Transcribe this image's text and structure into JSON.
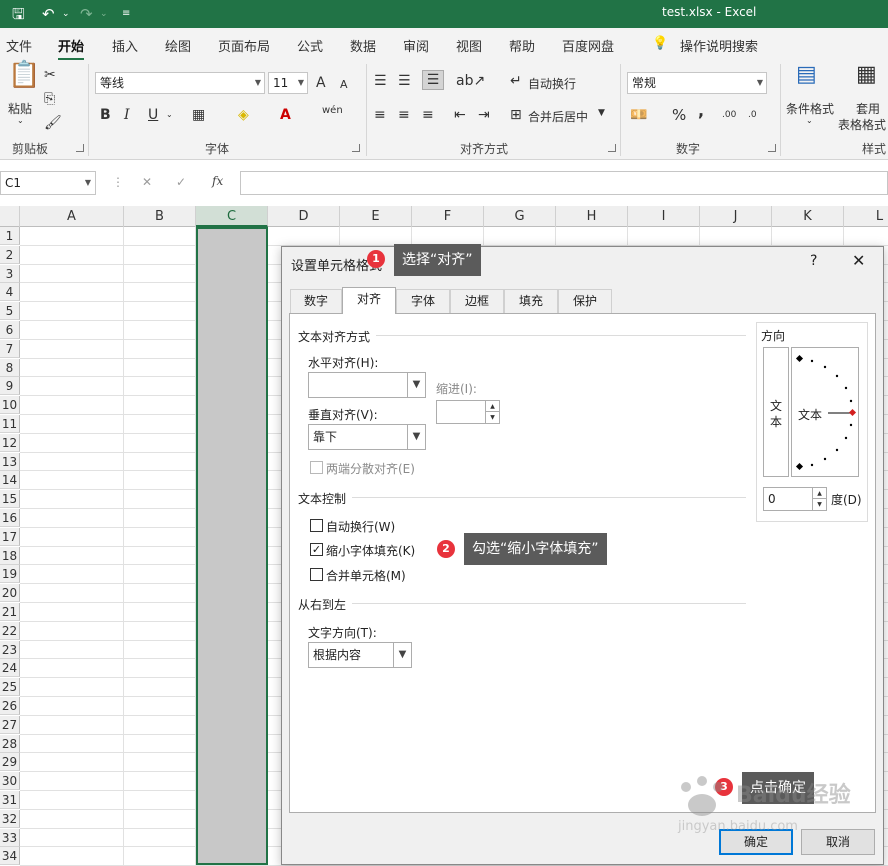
{
  "titlebar": {
    "title": "test.xlsx  -  Excel"
  },
  "ribbon_tabs": [
    "文件",
    "开始",
    "插入",
    "绘图",
    "页面布局",
    "公式",
    "数据",
    "审阅",
    "视图",
    "帮助",
    "百度网盘"
  ],
  "tell_me": "操作说明搜索",
  "clipboard": {
    "paste": "粘贴",
    "label": "剪贴板"
  },
  "font": {
    "name": "等线",
    "size": "11",
    "label": "字体",
    "bold": "B",
    "italic": "I",
    "underline": "U",
    "grow": "A",
    "shrink": "A",
    "wen": "wén"
  },
  "alignment": {
    "wrap": "自动换行",
    "merge": "合并后居中",
    "label": "对齐方式"
  },
  "number": {
    "format": "常规",
    "percent": "%",
    "comma": ",",
    "label": "数字"
  },
  "styles": {
    "conditional": "条件格式",
    "table1": "套用",
    "table2": "表格格式",
    "label": "样式"
  },
  "formula_bar": {
    "name_box": "C1",
    "fx": "fx",
    "cancel": "✕",
    "enter": "✓"
  },
  "grid": {
    "columns": [
      "A",
      "B",
      "C",
      "D",
      "E",
      "F",
      "G",
      "H",
      "I",
      "J",
      "K",
      "L"
    ],
    "rows": [
      "1",
      "2",
      "3",
      "4",
      "5",
      "6",
      "7",
      "8",
      "9",
      "10",
      "11",
      "12",
      "13",
      "14",
      "15",
      "16",
      "17",
      "18",
      "19",
      "20",
      "21",
      "22",
      "23",
      "24",
      "25",
      "26",
      "27",
      "28",
      "29",
      "30",
      "31",
      "32",
      "33",
      "34"
    ],
    "selected_column": "C"
  },
  "dialog": {
    "title": "设置单元格格式",
    "help": "?",
    "close": "✕",
    "tabs": [
      "数字",
      "对齐",
      "字体",
      "边框",
      "填充",
      "保护"
    ],
    "active_tab": "对齐",
    "text_alignment": {
      "section": "文本对齐方式",
      "horizontal_label": "水平对齐(H):",
      "horizontal_value": "",
      "indent_label": "缩进(I):",
      "indent_value": "",
      "vertical_label": "垂直对齐(V):",
      "vertical_value": "靠下",
      "justify_distributed": "两端分散对齐(E)"
    },
    "text_control": {
      "section": "文本控制",
      "wrap": {
        "label": "自动换行(W)",
        "checked": false
      },
      "shrink": {
        "label": "缩小字体填充(K)",
        "checked": true
      },
      "merge": {
        "label": "合并单元格(M)",
        "checked": false
      }
    },
    "rtl": {
      "section": "从右到左",
      "direction_label": "文字方向(T):",
      "direction_value": "根据内容"
    },
    "orientation": {
      "section": "方向",
      "vertical_text": "文本",
      "dial_text": "文本",
      "degrees": "0",
      "degree_label": "度(D)"
    },
    "ok": "确定",
    "cancel": "取消"
  },
  "annotations": [
    {
      "num": "1",
      "text": "选择“对齐”"
    },
    {
      "num": "2",
      "text": "勾选“缩小字体填充”"
    },
    {
      "num": "3",
      "text": "点击确定"
    }
  ],
  "watermark": {
    "brand": "Baidu经验",
    "url": "jingyan.baidu.com"
  },
  "colors": {
    "excel_green": "#217346",
    "callout_bg": "#5b5b5b",
    "badge_red": "#e8333c",
    "ok_border": "#0078d7"
  }
}
